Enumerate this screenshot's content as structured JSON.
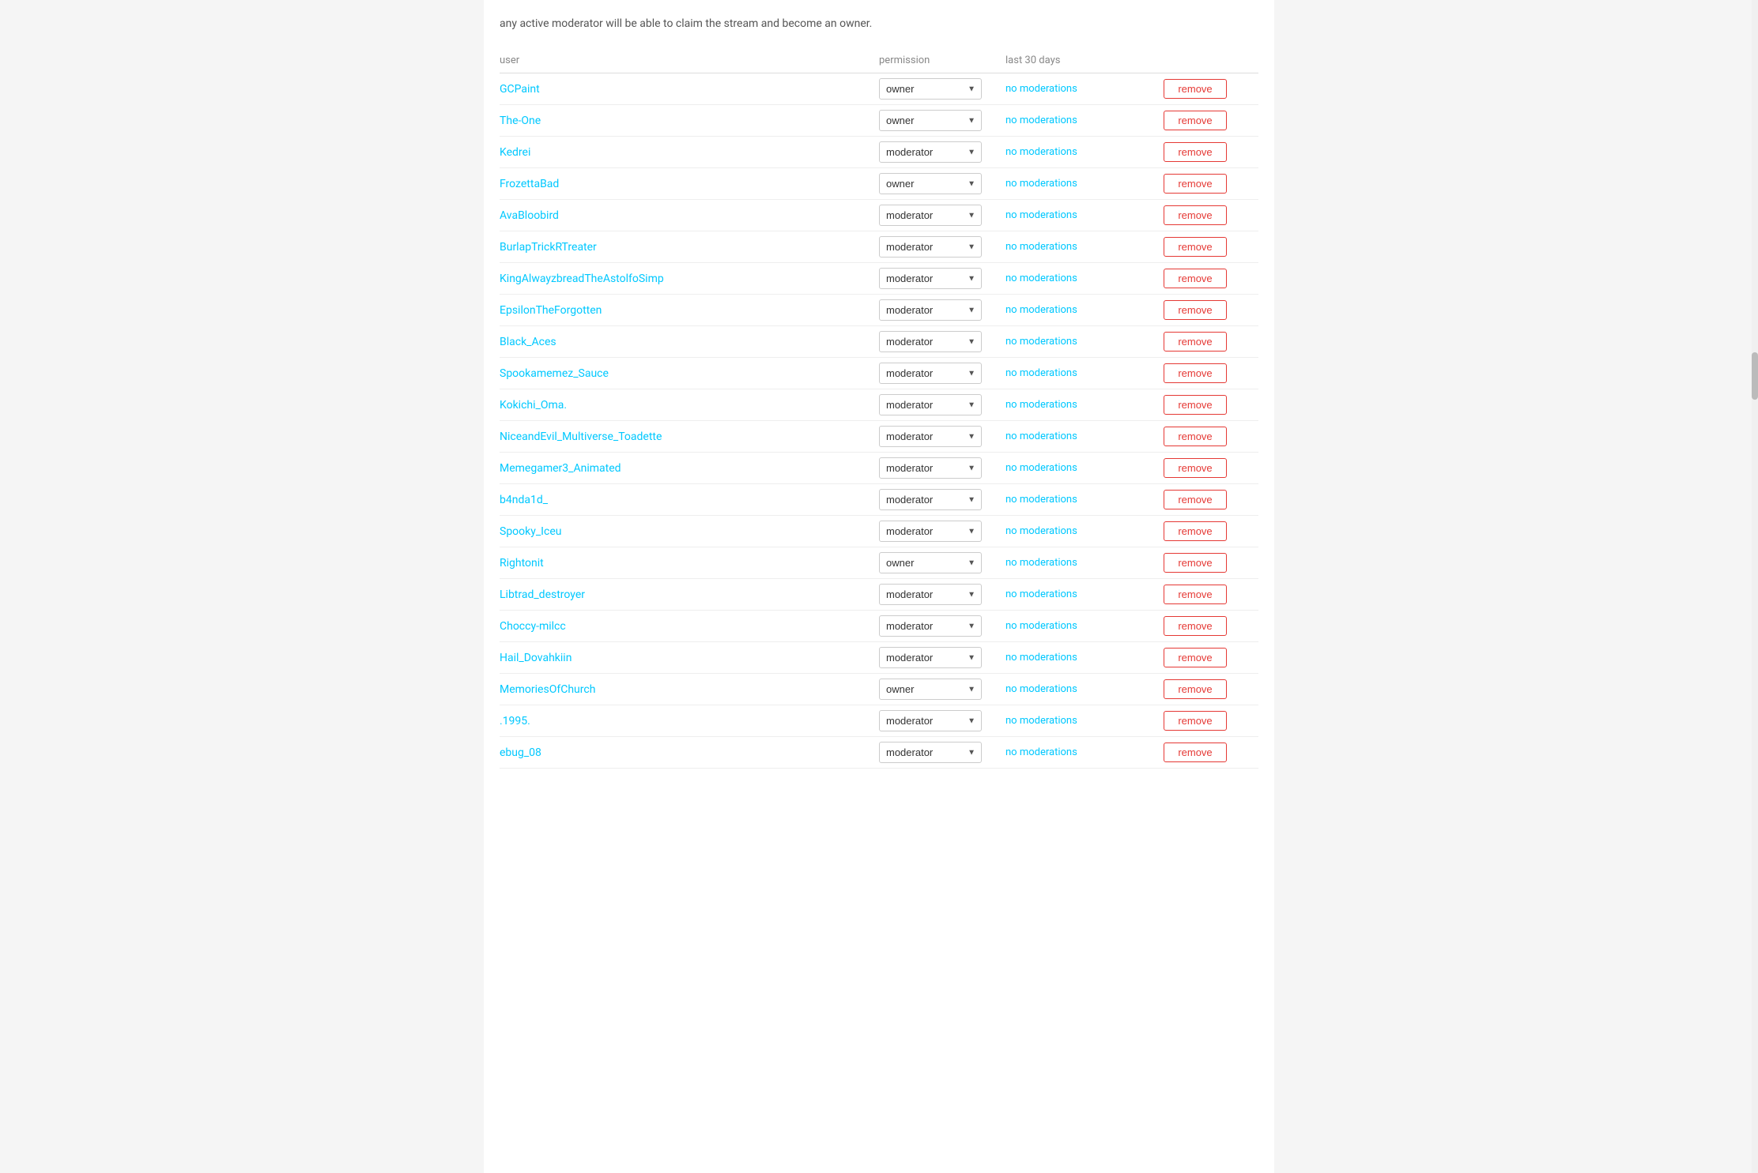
{
  "intro": {
    "text": "any active moderator will be able to claim the stream and become an owner."
  },
  "columns": {
    "user": "user",
    "permission": "permission",
    "last30days": "last 30 days"
  },
  "permission_options": [
    "owner",
    "moderator"
  ],
  "status_text": "no moderations",
  "remove_label": "remove",
  "rows": [
    {
      "user": "GCPaint",
      "permission": "owner"
    },
    {
      "user": "The-One",
      "permission": "owner"
    },
    {
      "user": "Kedrei",
      "permission": "moderator"
    },
    {
      "user": "FrozettaBad",
      "permission": "owner"
    },
    {
      "user": "AvaBloobird",
      "permission": "moderator"
    },
    {
      "user": "BurlapTrickRTreater",
      "permission": "moderator"
    },
    {
      "user": "KingAlwayzbreadTheAstolfoSimp",
      "permission": "moderator"
    },
    {
      "user": "EpsilonTheForgotten",
      "permission": "moderator"
    },
    {
      "user": "Black_Aces",
      "permission": "moderator"
    },
    {
      "user": "Spookamemez_Sauce",
      "permission": "moderator"
    },
    {
      "user": "Kokichi_Oma.",
      "permission": "moderator"
    },
    {
      "user": "NiceandEvil_Multiverse_Toadette",
      "permission": "moderator"
    },
    {
      "user": "Memegamer3_Animated",
      "permission": "moderator"
    },
    {
      "user": "b4nda1d_",
      "permission": "moderator"
    },
    {
      "user": "Spooky_Iceu",
      "permission": "moderator"
    },
    {
      "user": "Rightonit",
      "permission": "owner"
    },
    {
      "user": "Libtrad_destroyer",
      "permission": "moderator"
    },
    {
      "user": "Choccy-milcc",
      "permission": "moderator"
    },
    {
      "user": "Hail_Dovahkiin",
      "permission": "moderator"
    },
    {
      "user": "MemoriesOfChurch",
      "permission": "owner"
    },
    {
      "user": ".1995.",
      "permission": "moderator"
    },
    {
      "user": "ebug_08",
      "permission": "moderator"
    }
  ]
}
